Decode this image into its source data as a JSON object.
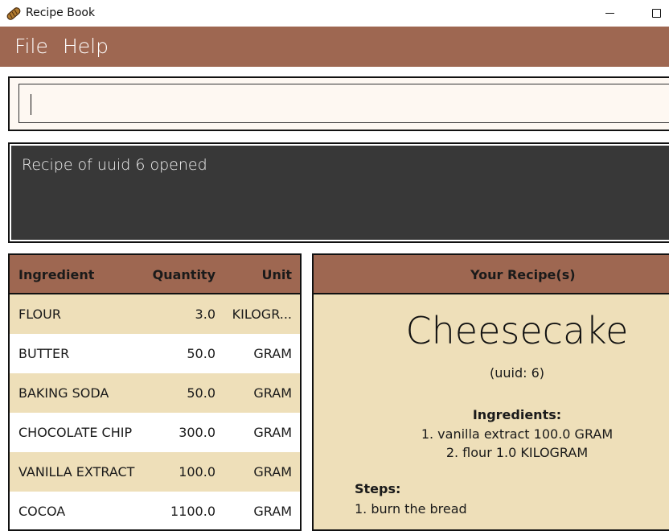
{
  "window": {
    "title": "Recipe Book",
    "icon": "bread-icon"
  },
  "menu": {
    "items": [
      {
        "label": "File"
      },
      {
        "label": "Help"
      }
    ]
  },
  "command": {
    "value": "",
    "placeholder": ""
  },
  "result": {
    "message": "Recipe of uuid 6 opened"
  },
  "ingredients_table": {
    "headers": {
      "ingredient": "Ingredient",
      "quantity": "Quantity",
      "unit": "Unit"
    },
    "rows": [
      {
        "name": "FLOUR",
        "quantity": "3.0",
        "unit": "KILOGR..."
      },
      {
        "name": "BUTTER",
        "quantity": "50.0",
        "unit": "GRAM"
      },
      {
        "name": "BAKING SODA",
        "quantity": "50.0",
        "unit": "GRAM"
      },
      {
        "name": "CHOCOLATE CHIP",
        "quantity": "300.0",
        "unit": "GRAM"
      },
      {
        "name": "VANILLA EXTRACT",
        "quantity": "100.0",
        "unit": "GRAM"
      },
      {
        "name": "COCOA",
        "quantity": "1100.0",
        "unit": "GRAM"
      }
    ]
  },
  "recipe": {
    "header": "Your Recipe(s)",
    "name": "Cheesecake",
    "uuid": "(uuid: 6)",
    "ingredients_title": "Ingredients:",
    "ingredients": [
      "1. vanilla extract 100.0 GRAM",
      "2. flour 1.0 KILOGRAM"
    ],
    "steps_title": "Steps:",
    "steps": [
      "1. burn the bread"
    ]
  },
  "colors": {
    "accent": "#9e6751",
    "row_alt": "#eedfb9",
    "result_bg": "#383838",
    "command_bg": "#fef8f2"
  }
}
